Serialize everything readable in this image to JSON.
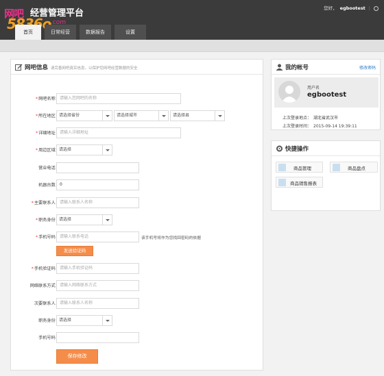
{
  "header": {
    "watermark_1": "网吧",
    "title": "经营管理平台",
    "watermark_2": "5836o",
    "watermark_3": ".com",
    "greeting": "您好，",
    "username": "egbootest"
  },
  "nav": {
    "tabs": [
      {
        "label": "首页"
      },
      {
        "label": "日常经营"
      },
      {
        "label": "数据报告"
      },
      {
        "label": "设置"
      }
    ]
  },
  "main": {
    "title": "网吧信息",
    "subtitle": "请完善网吧真实信息，以保护您网吧经营数据的安全",
    "fields": {
      "name": {
        "label": "网吧名称：",
        "placeholder": "请输入您网吧的名称"
      },
      "region": {
        "label": "所在地区：",
        "province": "请选择省份",
        "city": "请选择城市",
        "county": "请选择县"
      },
      "address": {
        "label": "详细地址：",
        "placeholder": "请输入详细地址"
      },
      "area": {
        "label": "周边区域：",
        "value": "请选择"
      },
      "phone": {
        "label": "营业电话："
      },
      "machines": {
        "label": "机器台数：",
        "value": "0"
      },
      "contact": {
        "label": "主要联系人：",
        "placeholder": "请输入联系人名称"
      },
      "position": {
        "label": "职务身份：",
        "value": "请选择"
      },
      "mobile": {
        "label": "手机号码：",
        "placeholder": "请输入联系电话",
        "hint": "该手机号将作为您找回密码的依据"
      },
      "send_code": "发送验证码",
      "code": {
        "label": "手机验证码：",
        "placeholder": "请输入手机验证码"
      },
      "network": {
        "label": "网络联系方式：",
        "placeholder": "请输入网络联系方式"
      },
      "contact2": {
        "label": "次要联系人：",
        "placeholder": "请输入联系人名称"
      },
      "position2": {
        "label": "职务身份：",
        "value": "请选择"
      },
      "mobile2": {
        "label": "手机号码："
      }
    },
    "save": "保存修改"
  },
  "account": {
    "title": "我的帐号",
    "edit": "修改密码",
    "user_label": "用户名",
    "user_value": "egbootest",
    "last_login_place_label": "上次登录地点：",
    "last_login_place": "湖北省武汉市",
    "last_login_time_label": "上次登录时间：",
    "last_login_time": "2015-09-14 19:39:11"
  },
  "quick": {
    "title": "快捷操作",
    "items": [
      {
        "label": "商品管理"
      },
      {
        "label": "商品盘点"
      },
      {
        "label": "商品销售报表"
      }
    ]
  }
}
